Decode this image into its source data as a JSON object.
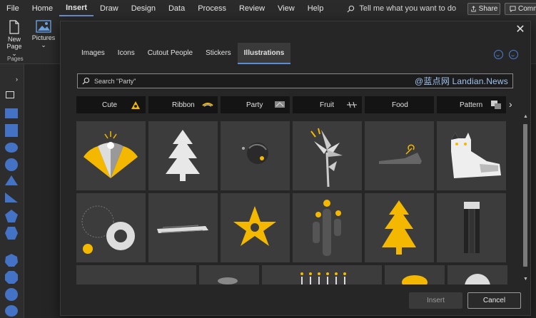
{
  "menu": {
    "items": [
      "File",
      "Home",
      "Insert",
      "Draw",
      "Design",
      "Data",
      "Process",
      "Review",
      "View",
      "Help"
    ],
    "active": "Insert",
    "tell_me": "Tell me what you want to do",
    "share": "Share",
    "comments": "Comm"
  },
  "ribbon": {
    "new_page": "New",
    "new_page_sub": "Page",
    "pictures": "Pictures",
    "pages_label": "Pages"
  },
  "dialog": {
    "tabs": [
      "Images",
      "Icons",
      "Cutout People",
      "Stickers",
      "Illustrations"
    ],
    "active_tab": "Illustrations",
    "search_placeholder": "Search \"Party\"",
    "watermark": "@蓝点网 Landian.News",
    "categories": [
      {
        "label": "Cute",
        "icon": "cute-icon"
      },
      {
        "label": "Ribbon",
        "icon": "ribbon-icon"
      },
      {
        "label": "Party",
        "icon": "party-icon"
      },
      {
        "label": "Fruit",
        "icon": "fruit-icon"
      },
      {
        "label": "Food",
        "icon": "food-icon"
      },
      {
        "label": "Pattern",
        "icon": "pattern-icon"
      }
    ],
    "illustrations": [
      "party-fans",
      "pine-tree",
      "ball",
      "lily",
      "shoe",
      "cat",
      "circles",
      "brush-stroke",
      "flower",
      "cactus",
      "yellow-tree",
      "paint-brushes",
      "partial-1",
      "partial-2",
      "candles",
      "partial-4",
      "partial-5"
    ],
    "insert": "Insert",
    "cancel": "Cancel"
  },
  "colors": {
    "accent": "#5a8ad8",
    "yellow": "#f5b800",
    "card": "#3c3c3c"
  }
}
